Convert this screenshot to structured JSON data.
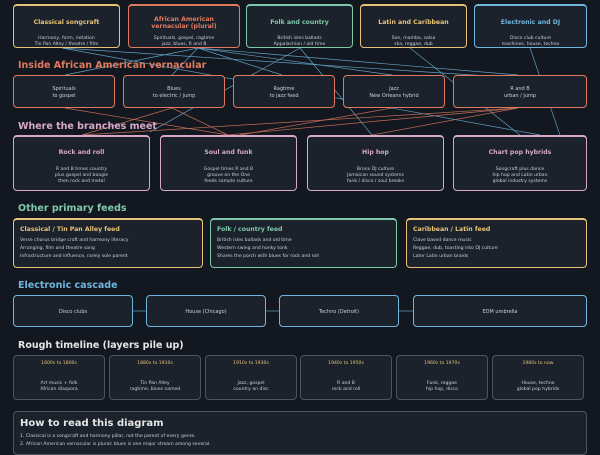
{
  "colors": {
    "background": "#131820",
    "classical": "#e8c276",
    "african": "#e07a5f",
    "folk": "#7fc8a9",
    "latin": "#e8c276",
    "electronic": "#6fb6de",
    "branches": "#d8a8c8",
    "timeline_year": "#e8c276"
  },
  "roots": [
    {
      "title": "Classical songcraft",
      "desc": [
        "Harmony, form, notation",
        "Tin Pan Alley / theatre / film"
      ]
    },
    {
      "title_lines": [
        "African American",
        "vernacular (plural)"
      ],
      "desc": [
        "Spirituals, gospel, ragtime",
        "jazz, blues, R and B"
      ]
    },
    {
      "title": "Folk and country",
      "desc": [
        "British isles ballads",
        "Appalachian / old time"
      ]
    },
    {
      "title": "Latin and Caribbean",
      "desc": [
        "Son, mambo, salsa",
        "ska, reggae, dub"
      ]
    },
    {
      "title": "Electronic and DJ",
      "desc": [
        "Disco club culture",
        "machines, house, techno"
      ]
    }
  ],
  "inside": {
    "heading": "Inside African American vernacular",
    "items": [
      [
        "Spirituals",
        "to gospel"
      ],
      [
        "Blues",
        "to electric / jump"
      ],
      [
        "Ragtime",
        "to jazz feed"
      ],
      [
        "Jazz",
        "New Orleans hybrid"
      ],
      [
        "R and B",
        "urban / jump"
      ]
    ]
  },
  "branches": {
    "heading": "Where the branches meet",
    "items": [
      {
        "title": "Rock and roll",
        "desc": [
          "R and B times country",
          "plus gospel and boogie",
          "then rock and metal"
        ]
      },
      {
        "title": "Soul and funk",
        "desc": [
          "Gospel times R and B",
          "groove on the One",
          "feeds sample culture"
        ]
      },
      {
        "title": "Hip hop",
        "desc": [
          "Bronx DJ culture",
          "Jamaican sound systems",
          "funk / disco / soul breaks"
        ]
      },
      {
        "title": "Chart pop hybrids",
        "desc": [
          "Songcraft plus dance",
          "hip hop and Latin urban",
          "global industry systems"
        ]
      }
    ]
  },
  "feeds": {
    "heading": "Other primary feeds",
    "items": [
      {
        "title": "Classical / Tin Pan Alley feed",
        "lines": [
          "Verse chorus bridge craft and harmony literacy",
          "Arranging, film and theatre song",
          "Infrastructure and influence, rarely sole parent"
        ]
      },
      {
        "title": "Folk / country feed",
        "lines": [
          "British isles ballads and old time",
          "Western swing and honky tonk",
          "Shares the porch with blues for rock and roll"
        ]
      },
      {
        "title": "Caribbean / Latin feed",
        "lines": [
          "Clave based dance music",
          "Reggae, dub, toasting into DJ culture",
          "Later Latin urban braids"
        ]
      }
    ]
  },
  "electronic": {
    "heading": "Electronic cascade",
    "items": [
      "Disco clubs",
      "House (Chicago)",
      "Techno (Detroit)",
      "EDM umbrella"
    ]
  },
  "timeline": {
    "heading": "Rough timeline (layers pile up)",
    "items": [
      {
        "years": "1600s to 1800s",
        "desc": [
          "Art music + folk",
          "African diaspora"
        ]
      },
      {
        "years": "1880s to 1910s",
        "desc": [
          "Tin Pan Alley",
          "ragtime, blues named"
        ]
      },
      {
        "years": "1910s to 1930s",
        "desc": [
          "Jazz, gospel",
          "country on disc"
        ]
      },
      {
        "years": "1940s to 1950s",
        "desc": [
          "R and B",
          "rock and roll"
        ]
      },
      {
        "years": "1960s to 1970s",
        "desc": [
          "Funk, reggae",
          "hip hop, disco"
        ]
      },
      {
        "years": "1980s to now",
        "desc": [
          "House, techno",
          "global pop hybrids"
        ]
      }
    ]
  },
  "howto": {
    "heading": "How to read this diagram",
    "lines": [
      "1. Classical is a songcraft and harmony pillar, not the parent of every genre.",
      "2. African American vernacular is plural: blues is one major stream among several."
    ]
  }
}
